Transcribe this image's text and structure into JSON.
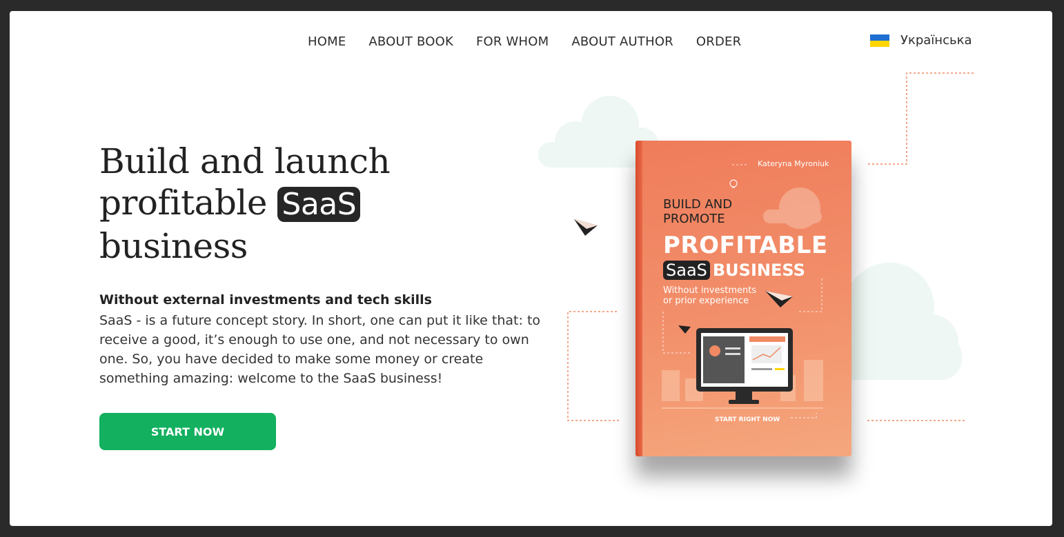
{
  "nav": {
    "items": [
      "HOME",
      "ABOUT BOOK",
      "FOR WHOM",
      "ABOUT AUTHOR",
      "ORDER"
    ]
  },
  "language": {
    "label": "Українська",
    "flag": "ukraine-flag-icon"
  },
  "hero": {
    "title_line1": "Build and launch",
    "title_line2_prefix": "profitable",
    "title_highlight": "SaaS",
    "title_line3": "business",
    "subtitle": "Without external investments and tech skills",
    "description": "SaaS - is a future concept story. In short, one can put it like that: to receive a good, it’s enough to use one, and not necessary to own one. So, you have decided to make some money or create something amazing: welcome to the SaaS business!",
    "cta_label": "START NOW"
  },
  "book": {
    "author": "Kateryna Myroniuk",
    "line1": "BUILD AND",
    "line2": "PROMOTE",
    "line3": "PROFITABLE",
    "highlight": "SaaS",
    "line4": "BUSINESS",
    "tagline1": "Without investments",
    "tagline2": "or  prior experience",
    "cta_small": "START RIGHT NOW"
  },
  "colors": {
    "accent_green": "#12b05f",
    "book_orange": "#f08a65",
    "dashed_line": "#f08a65",
    "cloud": "#eef7f3"
  }
}
